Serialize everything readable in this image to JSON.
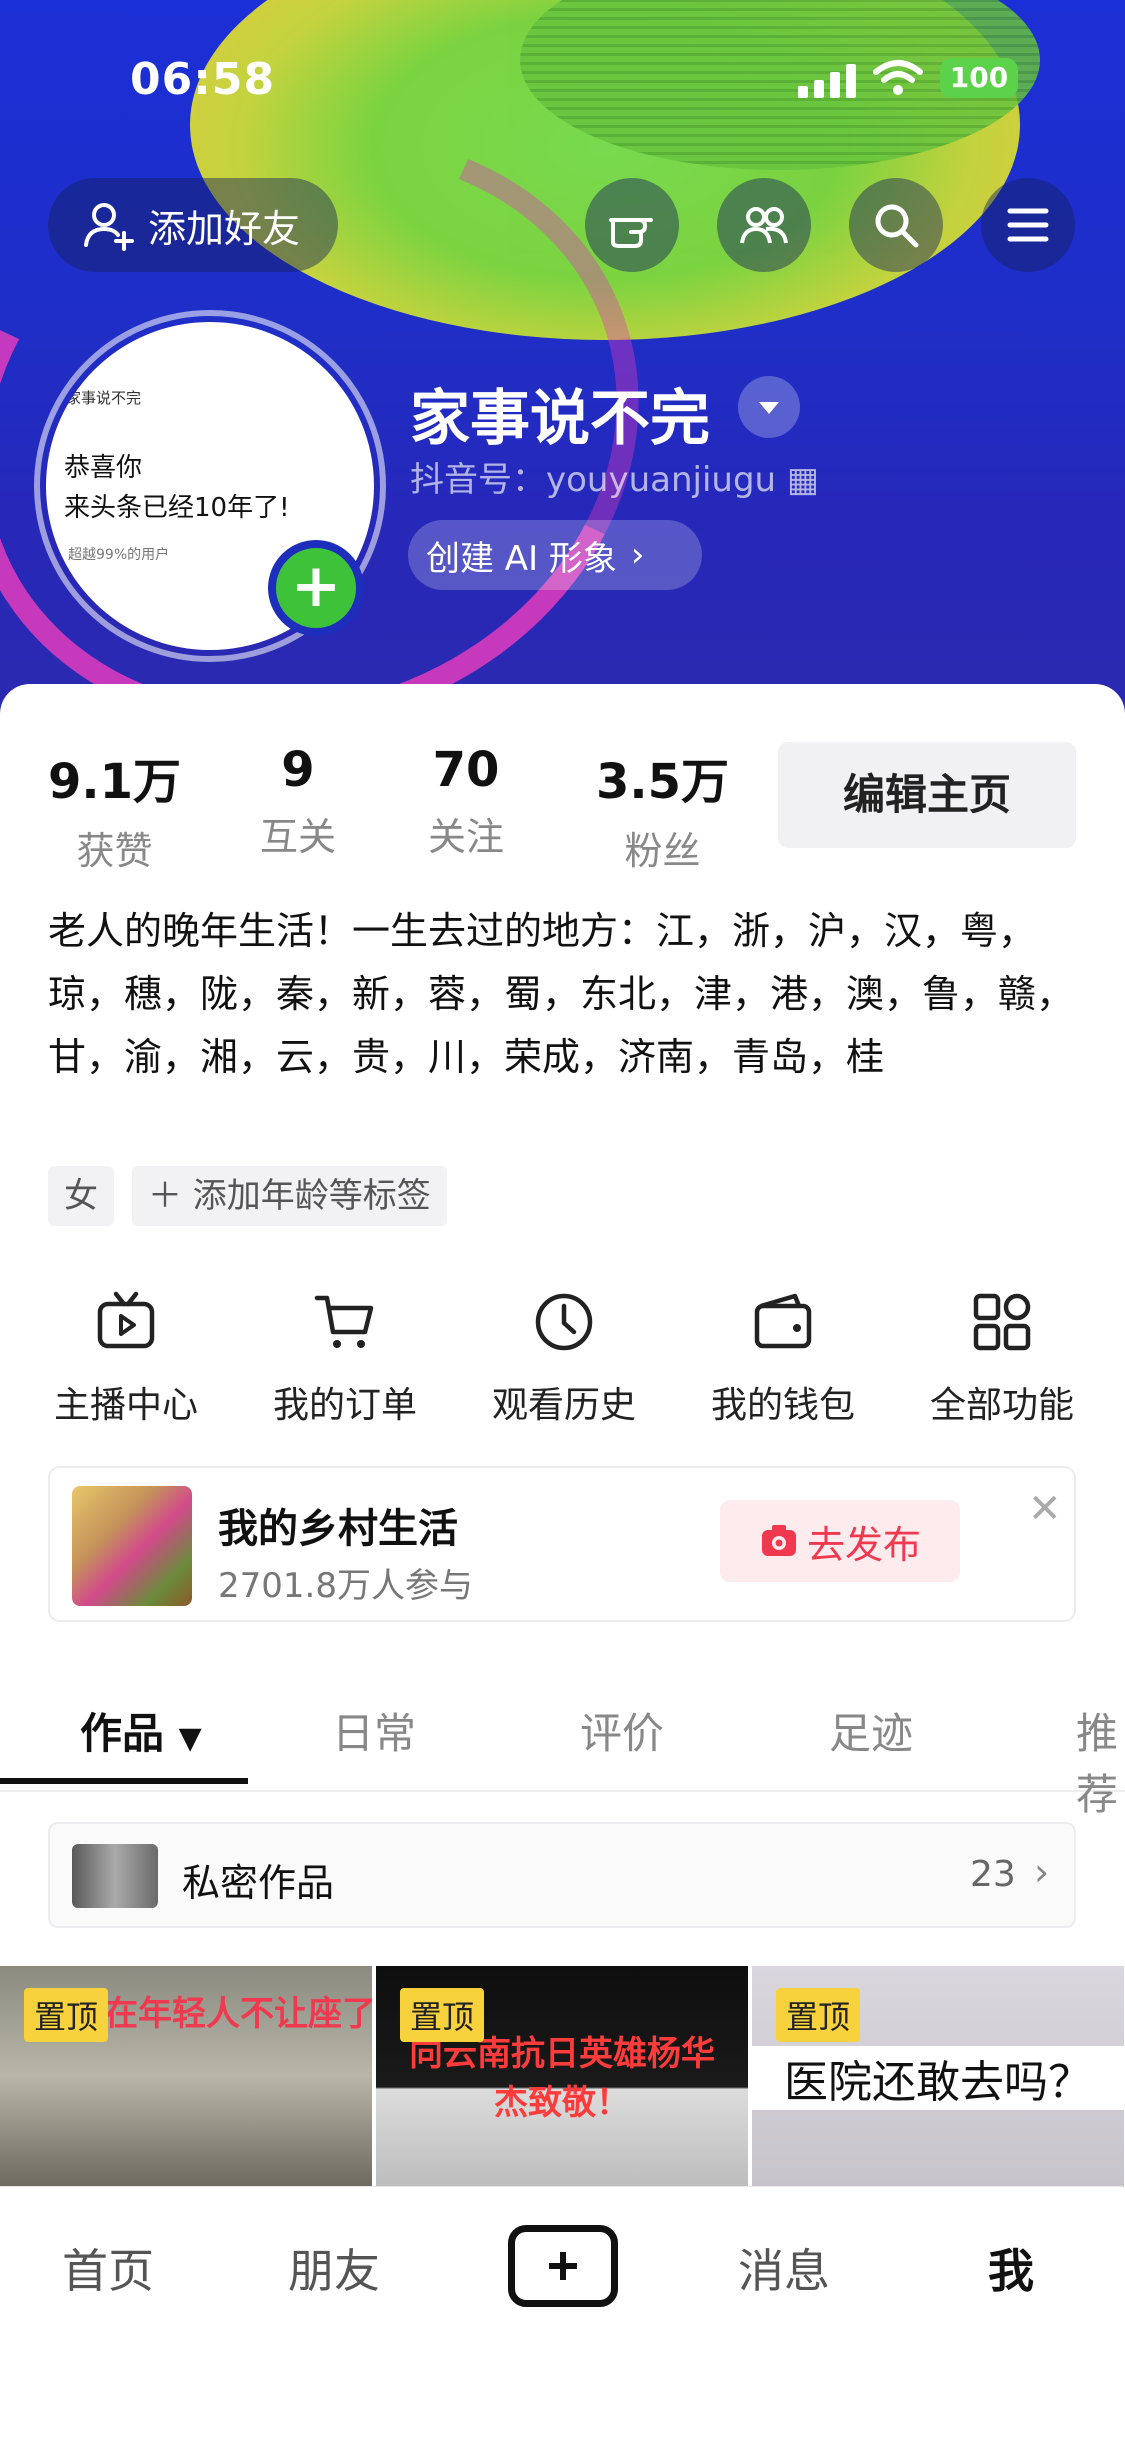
{
  "status_bar": {
    "time": "06:58",
    "battery": "100"
  },
  "header": {
    "add_friend_label": "添加好友",
    "nickname": "家事说不完",
    "douyin_id": "抖音号：youyuanjiugu",
    "ai_button_label": "创建 AI 形象",
    "avatar": {
      "line1": "家事说不完",
      "line2": "恭喜你",
      "line3": "来头条已经10年了!",
      "line4": "超越99%的用户"
    }
  },
  "stats": [
    {
      "value": "9.1万",
      "label": "获赞"
    },
    {
      "value": "9",
      "label": "互关"
    },
    {
      "value": "70",
      "label": "关注"
    },
    {
      "value": "3.5万",
      "label": "粉丝"
    }
  ],
  "edit_profile_label": "编辑主页",
  "bio": "老人的晚年生活！一生去过的地方：江，浙，沪，汉，粤，琼，穗，陇，秦，新，蓉，蜀，东北，津，港，澳，鲁，赣，甘，渝，湘，云，贵，川，荣成，济南，青岛，桂",
  "tags": {
    "gender": "女",
    "add_tag": "＋ 添加年龄等标签"
  },
  "features": [
    {
      "label": "主播中心",
      "icon": "tv-play-icon"
    },
    {
      "label": "我的订单",
      "icon": "cart-icon"
    },
    {
      "label": "观看历史",
      "icon": "clock-icon"
    },
    {
      "label": "我的钱包",
      "icon": "wallet-icon"
    },
    {
      "label": "全部功能",
      "icon": "grid-icon"
    }
  ],
  "banner": {
    "title": "我的乡村生活",
    "subtitle": "2701.8万人参与",
    "button_label": "去发布"
  },
  "tabs": [
    {
      "label": "作品"
    },
    {
      "label": "日常"
    },
    {
      "label": "评价"
    },
    {
      "label": "足迹"
    },
    {
      "label": "推荐"
    }
  ],
  "private_works": {
    "label": "私密作品",
    "count": "23"
  },
  "videos": [
    {
      "pin": "置顶",
      "caption": "发现在年轻人不让座了"
    },
    {
      "pin": "置顶",
      "caption": "向云南抗日英雄杨华杰致敬！"
    },
    {
      "pin": "置顶",
      "caption": "医院还敢去吗？"
    }
  ],
  "bottom_nav": [
    {
      "label": "首页"
    },
    {
      "label": "朋友"
    },
    {
      "label": "消息"
    },
    {
      "label": "我"
    }
  ],
  "colors": {
    "accent_red": "#f0384e",
    "pin_yellow": "#f7d23c",
    "header_blue": "#1f2ec7"
  }
}
